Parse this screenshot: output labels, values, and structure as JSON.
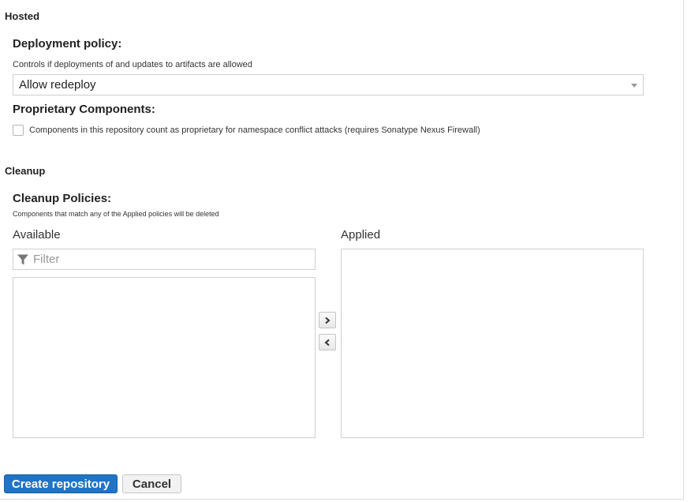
{
  "hosted": {
    "heading": "Hosted",
    "deployment_policy": {
      "label": "Deployment policy:",
      "help": "Controls if deployments of and updates to artifacts are allowed",
      "selected": "Allow redeploy"
    },
    "proprietary": {
      "label": "Proprietary Components:",
      "checkbox_label": "Components in this repository count as proprietary for namespace conflict attacks (requires Sonatype Nexus Firewall)",
      "checked": false
    }
  },
  "cleanup": {
    "heading": "Cleanup",
    "policies": {
      "label": "Cleanup Policies:",
      "help": "Components that match any of the Applied policies will be deleted",
      "available_title": "Available",
      "applied_title": "Applied",
      "filter_placeholder": "Filter",
      "available_items": [],
      "applied_items": []
    }
  },
  "icons": {
    "filter": "filter-icon",
    "move_right": "chevron-right-icon",
    "move_left": "chevron-left-icon",
    "dropdown": "caret-down-icon"
  },
  "actions": {
    "create_label": "Create repository",
    "cancel_label": "Cancel"
  },
  "colors": {
    "primary": "#1f74c6",
    "border": "#cfcfcf"
  }
}
